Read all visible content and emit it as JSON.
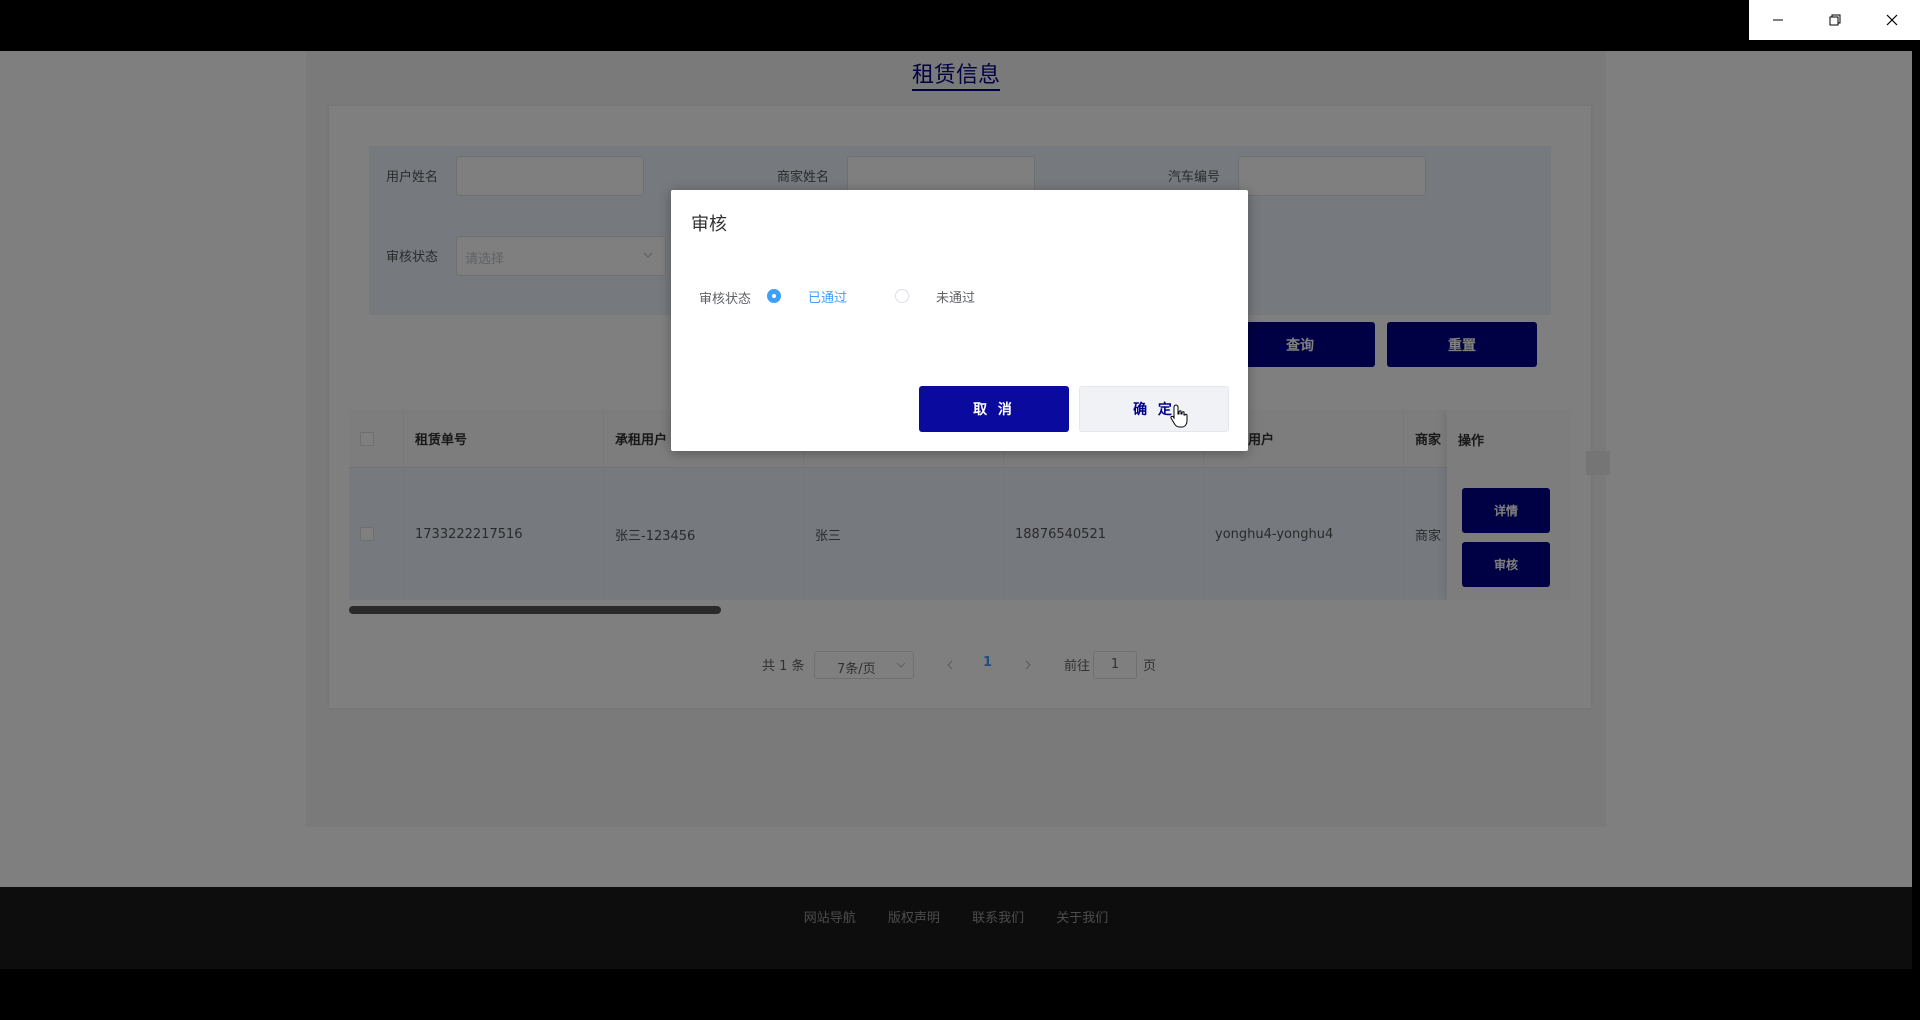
{
  "page": {
    "title": "租赁信息"
  },
  "filters": {
    "user_name_label": "用户姓名",
    "merchant_name_label": "商家姓名",
    "car_number_label": "汽车编号",
    "review_status_label": "审核状态",
    "review_status_placeholder": "请选择",
    "query_button": "查询",
    "reset_button": "重置"
  },
  "table": {
    "columns": [
      "租赁单号",
      "承租用户",
      "",
      "",
      "用户",
      "商家",
      "操作"
    ],
    "rows": [
      {
        "order_no": "1733222217516",
        "tenant": "张三-123456",
        "name": "张三",
        "phone": "18876540521",
        "user": "yonghu4-yonghu4",
        "merchant": "商家"
      }
    ],
    "detail_button": "详情",
    "review_button": "审核"
  },
  "pagination": {
    "total_text": "共 1 条",
    "page_size": "7条/页",
    "current_page": "1",
    "goto_label": "前往",
    "goto_value": "1",
    "page_suffix": "页"
  },
  "footer": {
    "links": [
      "网站导航",
      "版权声明",
      "联系我们",
      "关于我们"
    ]
  },
  "dialog": {
    "title": "审核",
    "status_label": "审核状态",
    "option_passed": "已通过",
    "option_failed": "未通过",
    "selected": "已通过",
    "cancel_button": "取 消",
    "ok_button": "确 定"
  },
  "colors": {
    "primary_dark": "#00008b",
    "radio_active": "#409eff"
  }
}
